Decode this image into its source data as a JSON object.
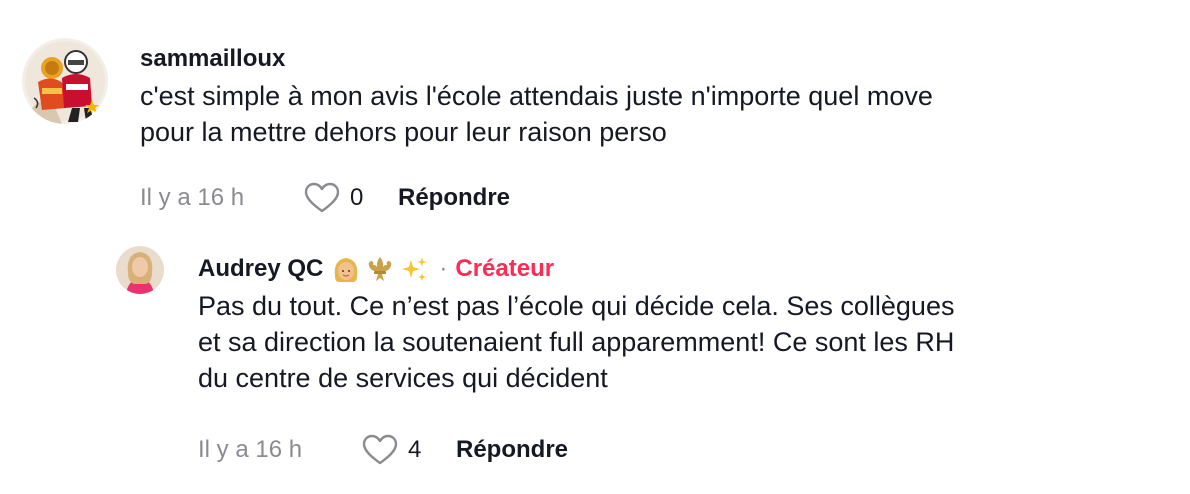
{
  "comments": [
    {
      "username": "sammailloux",
      "text": "c'est simple à mon avis l'école attendais juste n'importe quel move\npour la mettre dehors pour leur raison perso",
      "time": "Il y a 16 h",
      "likes": "0",
      "reply_label": "Répondre",
      "avatar_icon": "hockey-players-avatar"
    },
    {
      "username": "Audrey QC",
      "emoji_icons": [
        "blonde-woman-emoji",
        "fleur-de-lis-emoji",
        "sparkles-emoji"
      ],
      "separator": "·",
      "badge": "Créateur",
      "text": "Pas du tout. Ce n’est pas l’école qui décide cela. Ses collègues\net sa direction la soutenaient full apparemment! Ce sont les RH\ndu centre de services qui décident",
      "time": "Il y a 16 h",
      "likes": "4",
      "reply_label": "Répondre",
      "avatar_icon": "woman-portrait-avatar"
    }
  ],
  "colors": {
    "text": "#161823",
    "muted": "#8a8b91",
    "creator": "#fe2c55"
  }
}
